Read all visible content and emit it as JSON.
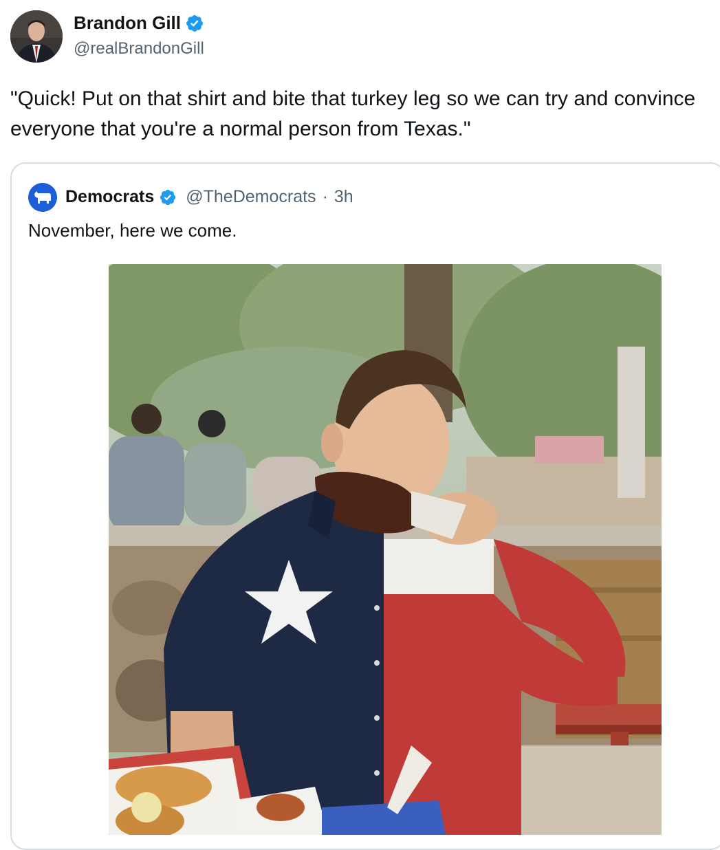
{
  "tweet": {
    "author": {
      "display_name": "Brandon Gill",
      "handle": "@realBrandonGill",
      "verified": true,
      "avatar_icon": "profile-photo"
    },
    "text": "\"Quick! Put on that shirt and bite that turkey leg so we can try and convince everyone that you're a normal person from Texas.\""
  },
  "quoted_tweet": {
    "author": {
      "display_name": "Democrats",
      "handle": "@TheDemocrats",
      "separator": "·",
      "time": "3h",
      "verified": true,
      "avatar_icon": "donkey-logo-icon"
    },
    "text": "November, here we come."
  },
  "colors": {
    "verified_blue": "#1d9bf0",
    "text_primary": "#0f1419",
    "text_secondary": "#536471",
    "border": "#d6dde2",
    "democrats_blue": "#1d5fd6"
  }
}
